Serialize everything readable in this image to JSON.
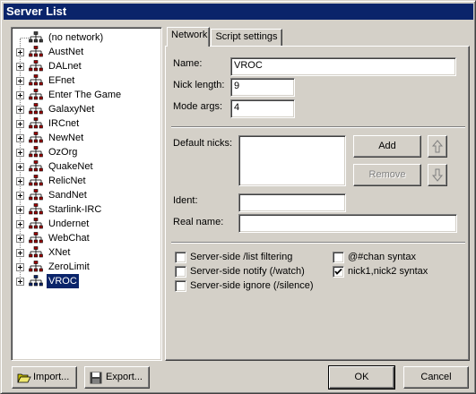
{
  "window": {
    "title": "Server List"
  },
  "tree": {
    "items": [
      {
        "label": "(no network)",
        "expandable": false,
        "selected": false
      },
      {
        "label": "AustNet",
        "expandable": true,
        "selected": false
      },
      {
        "label": "DALnet",
        "expandable": true,
        "selected": false
      },
      {
        "label": "EFnet",
        "expandable": true,
        "selected": false
      },
      {
        "label": "Enter The Game",
        "expandable": true,
        "selected": false
      },
      {
        "label": "GalaxyNet",
        "expandable": true,
        "selected": false
      },
      {
        "label": "IRCnet",
        "expandable": true,
        "selected": false
      },
      {
        "label": "NewNet",
        "expandable": true,
        "selected": false
      },
      {
        "label": "OzOrg",
        "expandable": true,
        "selected": false
      },
      {
        "label": "QuakeNet",
        "expandable": true,
        "selected": false
      },
      {
        "label": "RelicNet",
        "expandable": true,
        "selected": false
      },
      {
        "label": "SandNet",
        "expandable": true,
        "selected": false
      },
      {
        "label": "Starlink-IRC",
        "expandable": true,
        "selected": false
      },
      {
        "label": "Undernet",
        "expandable": true,
        "selected": false
      },
      {
        "label": "WebChat",
        "expandable": true,
        "selected": false
      },
      {
        "label": "XNet",
        "expandable": true,
        "selected": false
      },
      {
        "label": "ZeroLimit",
        "expandable": true,
        "selected": false
      },
      {
        "label": "VROC",
        "expandable": true,
        "selected": true
      }
    ],
    "icon": "network-icon"
  },
  "tabs": [
    {
      "label": "Network",
      "active": true
    },
    {
      "label": "Script settings",
      "active": false
    }
  ],
  "network": {
    "name_label": "Name:",
    "name_value": "VROC",
    "nick_length_label": "Nick length:",
    "nick_length_value": "9",
    "mode_args_label": "Mode args:",
    "mode_args_value": "4",
    "default_nicks_label": "Default nicks:",
    "default_nicks_value": "",
    "add_label": "Add",
    "remove_label": "Remove",
    "ident_label": "Ident:",
    "ident_value": "",
    "real_name_label": "Real name:",
    "real_name_value": ""
  },
  "options": [
    {
      "label": "Server-side /list filtering",
      "checked": false
    },
    {
      "label": "Server-side notify (/watch)",
      "checked": false
    },
    {
      "label": "Server-side ignore (/silence)",
      "checked": false
    },
    {
      "label": "@#chan syntax",
      "checked": false
    },
    {
      "label": "nick1,nick2 syntax",
      "checked": true
    }
  ],
  "footer": {
    "import_label": "Import...",
    "export_label": "Export...",
    "ok_label": "OK",
    "cancel_label": "Cancel"
  },
  "colors": {
    "titlebar": "#0a246a",
    "face": "#d4d0c8",
    "selection": "#0a246a"
  }
}
